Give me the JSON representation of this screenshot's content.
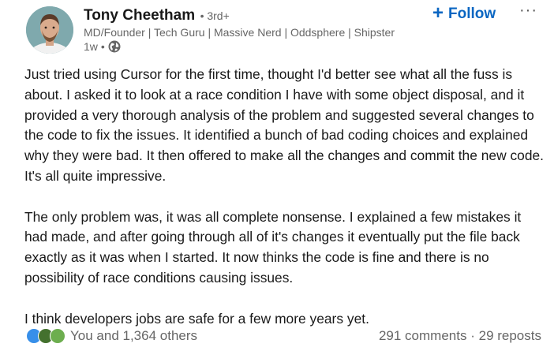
{
  "author": {
    "name": "Tony Cheetham",
    "degree": "• 3rd+",
    "headline": "MD/Founder | Tech Guru | Massive Nerd | Oddsphere | Shipster",
    "time": "1w",
    "separator": "•",
    "visibility_icon": "globe-icon"
  },
  "actions": {
    "follow_label": "Follow",
    "follow_icon": "plus-icon",
    "more_icon": "more-options-icon"
  },
  "post": {
    "paragraphs": [
      "Just tried using Cursor for the first time, thought I'd better see what all the fuss is about. I asked it to look at a race condition I have with some object disposal, and it provided a very thorough analysis of the problem and suggested several changes to the code to fix the issues. It identified a bunch of bad coding choices and explained why they were bad. It then offered to make all the changes and commit the new code. It's all quite impressive.",
      "The only problem was, it was all complete nonsense. I explained a few mistakes it had made, and after going through all of it's changes it eventually put the file back exactly as it was when I started. It now thinks the code is fine and there is no possibility of race conditions causing issues.",
      "I think developers jobs are safe for a few more years yet."
    ]
  },
  "social": {
    "reaction_icons": [
      "like-icon",
      "celebrate-icon",
      "support-icon"
    ],
    "reactions_text": "You and 1,364 others",
    "comments_text": "291 comments",
    "separator": "·",
    "reposts_text": "29 reposts"
  },
  "colors": {
    "accent": "#0a66c2",
    "muted_text": "#666666",
    "like": "#378fe9",
    "celebrate": "#44712e",
    "support": "#6dae4f"
  }
}
